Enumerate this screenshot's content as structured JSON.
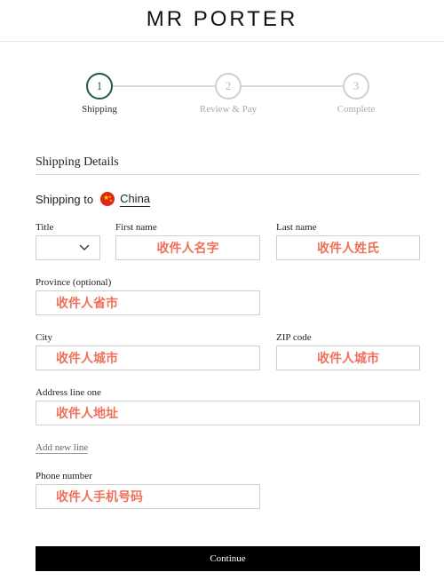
{
  "brand": {
    "logo": "MR PORTER"
  },
  "stepper": {
    "steps": [
      {
        "number": "1",
        "label": "Shipping"
      },
      {
        "number": "2",
        "label": "Review & Pay"
      },
      {
        "number": "3",
        "label": "Complete"
      }
    ],
    "active_step": 1
  },
  "section": {
    "title": "Shipping Details"
  },
  "shipping": {
    "prefix": "Shipping to",
    "country": "China",
    "flag_icon": "china-flag-icon"
  },
  "form": {
    "title_label": "Title",
    "title_value": "",
    "first_name_label": "First name",
    "first_name_value": "收件人名字",
    "last_name_label": "Last name",
    "last_name_value": "收件人姓氏",
    "province_label": "Province (optional)",
    "province_value": "收件人省市",
    "city_label": "City",
    "city_value": "收件人城市",
    "zip_label": "ZIP code",
    "zip_value": "收件人城市",
    "address_label": "Address line one",
    "address_value": "收件人地址",
    "add_line": "Add new line",
    "phone_label": "Phone number",
    "phone_value": "收件人手机号码"
  },
  "actions": {
    "continue": "Continue"
  },
  "colors": {
    "accent": "#1f5a43",
    "overlay_text": "#f0705a",
    "button_bg": "#000000"
  }
}
